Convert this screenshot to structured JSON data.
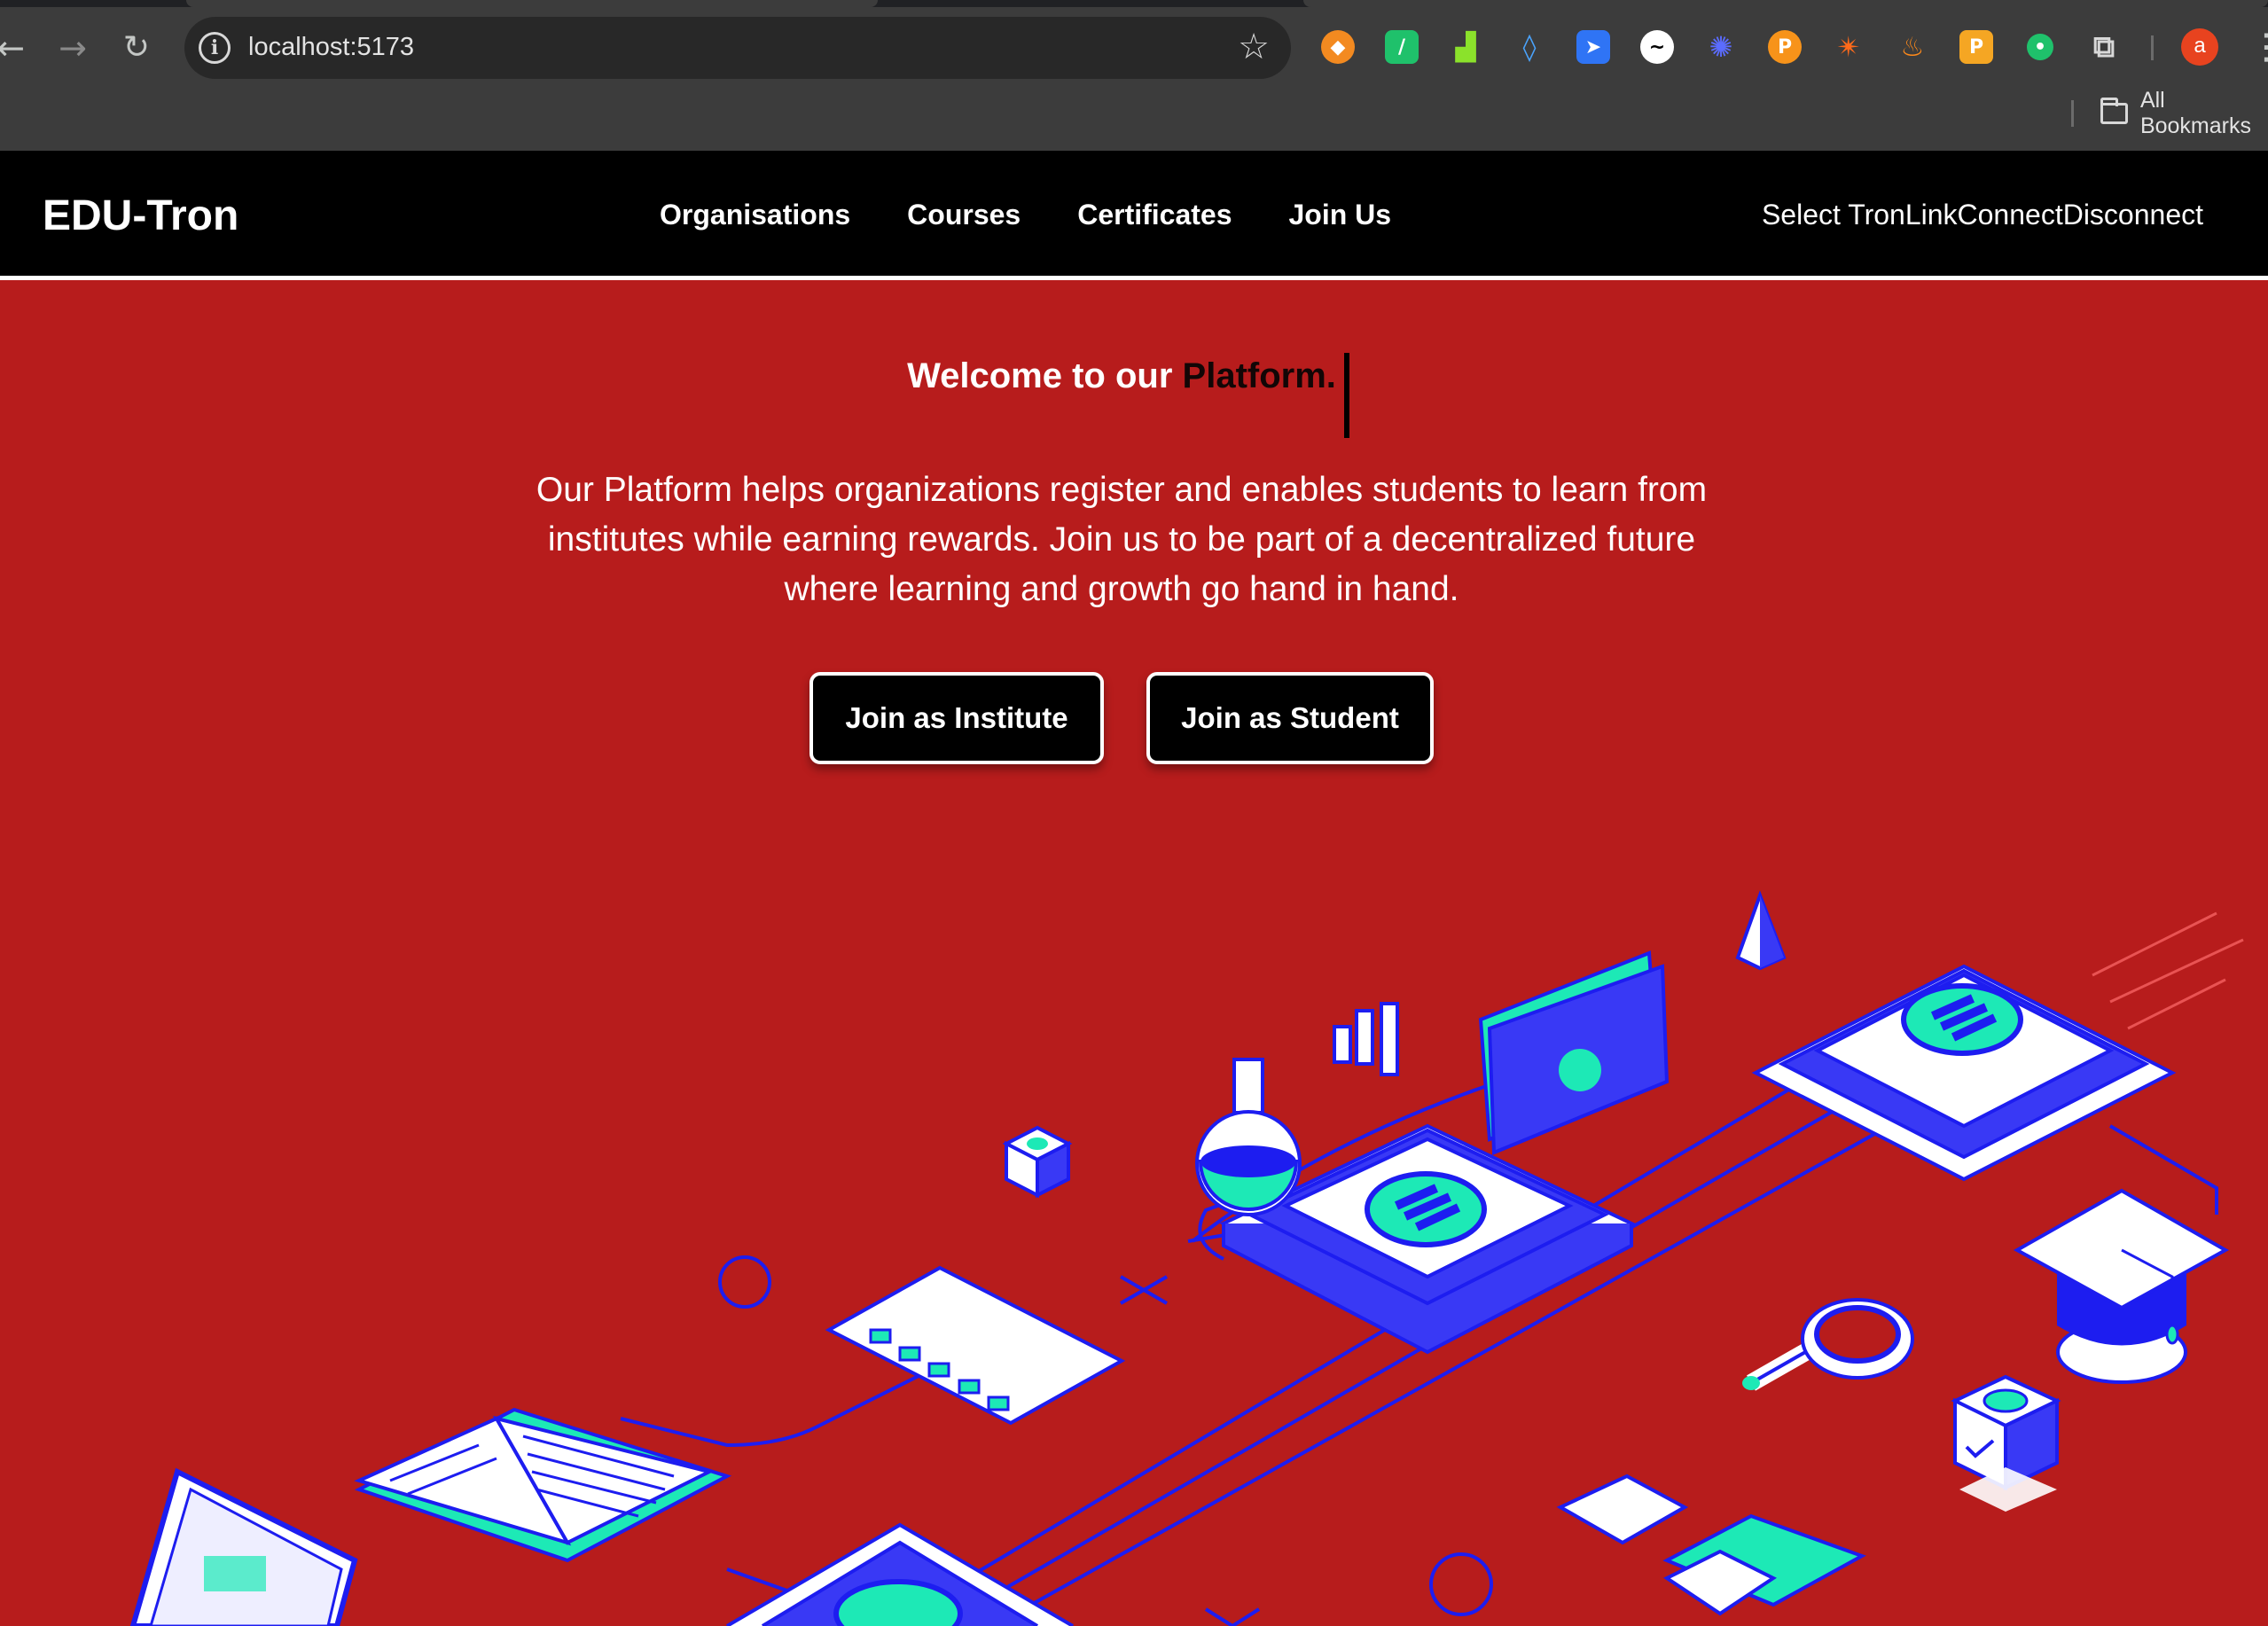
{
  "browser": {
    "url": "localhost:5173",
    "profile_initial": "a",
    "bookmarks_label": "All Bookmarks",
    "extensions": [
      "fox-icon",
      "green-box-icon",
      "chart-icon",
      "drop-icon",
      "arrow-icon",
      "wave-icon",
      "burst-icon",
      "p-icon",
      "spark-icon",
      "flame-icon",
      "square-p-icon",
      "dot-icon"
    ]
  },
  "header": {
    "brand": "EDU-Tron",
    "nav": [
      "Organisations",
      "Courses",
      "Certificates",
      "Join Us"
    ],
    "wallet": {
      "select": "Select TronLink",
      "connect": "Connect",
      "disconnect": "Disconnect"
    }
  },
  "hero": {
    "title_prefix": "Welcome to our ",
    "title_accent": "Platform.",
    "description": "Our Platform helps organizations register and enables students to learn from institutes while earning rewards. Join us to be part of a decentralized future where learning and growth go hand in hand.",
    "buttons": {
      "institute": "Join as Institute",
      "student": "Join as Student"
    }
  },
  "colors": {
    "hero_bg": "#b71c1c",
    "header_bg": "#000000",
    "illustration_blue": "#1d1df0",
    "illustration_teal": "#1de9b6"
  }
}
